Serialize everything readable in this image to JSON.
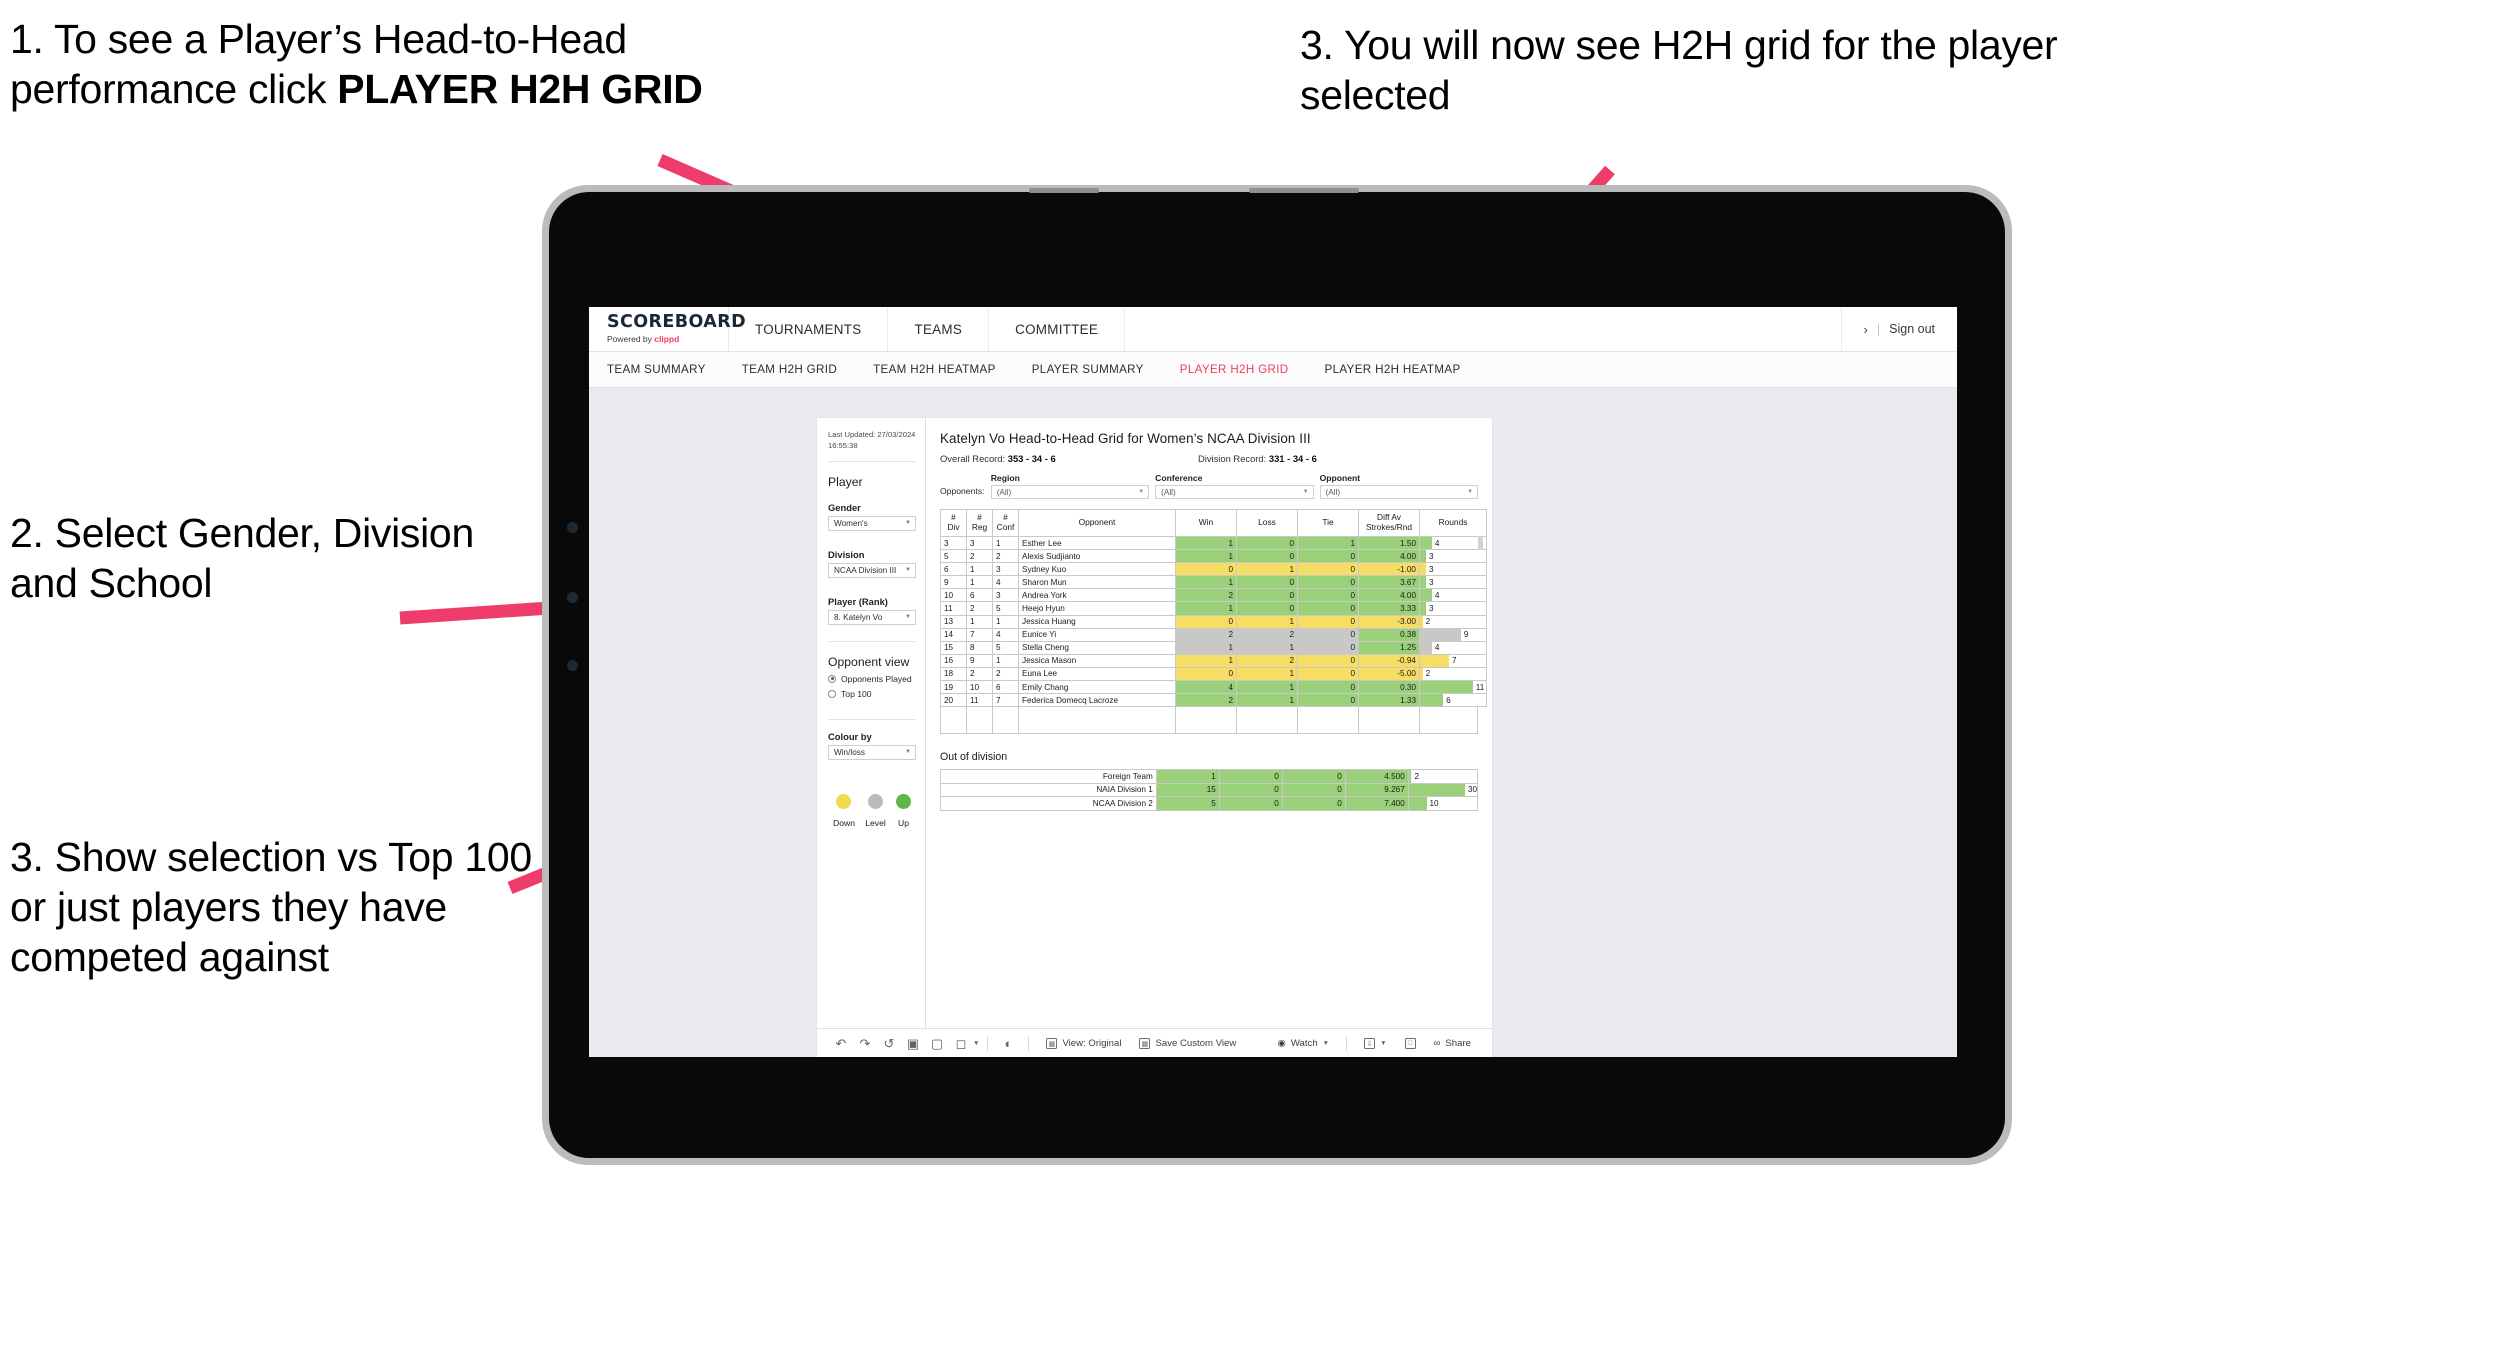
{
  "annotations": {
    "step1_a": "1. To see a Player’s Head-to-Head performance click ",
    "step1_bold": "PLAYER H2H GRID",
    "step2": "2. Select Gender, Division and School",
    "step3_left": "3. Show selection vs Top 100 or just players they have competed against",
    "step3_right": "3. You will now see H2H grid for the player selected"
  },
  "colors": {
    "accent_pink": "#ee3d6b",
    "brand_red": "#ef3e5c",
    "up_green": "#9bd07a",
    "down_yellow": "#f5de63",
    "level_grey": "#c8c8c8",
    "canvas_grey": "#e9ebee"
  },
  "brand": {
    "logo_word": "SCOREBOARD",
    "logo_powered": "Powered by ",
    "logo_partner": "clippd"
  },
  "topnav": {
    "items": [
      {
        "label": "TOURNAMENTS"
      },
      {
        "label": "TEAMS"
      },
      {
        "label": "COMMITTEE"
      }
    ],
    "chevron": "›",
    "separator": "|",
    "signout": "Sign out"
  },
  "subnav": {
    "items": [
      {
        "label": "TEAM SUMMARY",
        "active": false
      },
      {
        "label": "TEAM H2H GRID",
        "active": false
      },
      {
        "label": "TEAM H2H HEATMAP",
        "active": false
      },
      {
        "label": "PLAYER SUMMARY",
        "active": false
      },
      {
        "label": "PLAYER H2H GRID",
        "active": true
      },
      {
        "label": "PLAYER H2H HEATMAP",
        "active": false
      }
    ]
  },
  "controls": {
    "last_updated": "Last Updated: 27/03/2024 16:55:38",
    "player_heading": "Player",
    "gender_label": "Gender",
    "gender_value": "Women's",
    "division_label": "Division",
    "division_value": "NCAA Division III",
    "player_rank_label": "Player (Rank)",
    "player_rank_value": "8. Katelyn Vo",
    "opponent_view_heading": "Opponent view",
    "opponent_view_options": [
      {
        "label": "Opponents Played",
        "selected": true
      },
      {
        "label": "Top 100",
        "selected": false
      }
    ],
    "colour_by_label": "Colour by",
    "colour_by_value": "Win/loss",
    "legend": [
      {
        "name": "Down",
        "color": "#f5de63"
      },
      {
        "name": "Level",
        "color": "#c8c8c8"
      },
      {
        "name": "Up",
        "color": "#7ec45a"
      }
    ]
  },
  "main": {
    "title": "Katelyn Vo Head-to-Head Grid for Women’s NCAA Division III",
    "overall_record_label": "Overall Record: ",
    "overall_record_value": "353 -  34 - 6",
    "division_record_label": "Division Record: ",
    "division_record_value": "331 -  34 - 6",
    "opponents_label": "Opponents:",
    "filters": [
      {
        "label": "Region",
        "value": "(All)"
      },
      {
        "label": "Conference",
        "value": "(All)"
      },
      {
        "label": "Opponent",
        "value": "(All)"
      }
    ]
  },
  "chart_data": {
    "type": "table",
    "title": "Katelyn Vo Head-to-Head Grid for Women’s NCAA Division III",
    "columns": [
      "# Div",
      "# Reg",
      "# Conf",
      "Opponent",
      "Win",
      "Loss",
      "Tie",
      "Diff Av Strokes/Rnd",
      "Rounds"
    ],
    "column_headers_multiline": [
      [
        "#",
        "Div"
      ],
      [
        "#",
        "Reg"
      ],
      [
        "#",
        "Conf"
      ],
      [
        "Opponent"
      ],
      [
        "Win"
      ],
      [
        "Loss"
      ],
      [
        "Tie"
      ],
      [
        "Diff Av",
        "Strokes/Rnd"
      ],
      [
        "Rounds"
      ]
    ],
    "rows": [
      {
        "div": "3",
        "reg": "3",
        "conf": "1",
        "opponent": "Esther Lee",
        "win": "1",
        "loss": "0",
        "tie": "1",
        "diff": "1.50",
        "rounds": "4",
        "bar_pct": 18,
        "state": "up"
      },
      {
        "div": "5",
        "reg": "2",
        "conf": "2",
        "opponent": "Alexis Sudjianto",
        "win": "1",
        "loss": "0",
        "tie": "0",
        "diff": "4.00",
        "rounds": "3",
        "bar_pct": 9,
        "state": "up"
      },
      {
        "div": "6",
        "reg": "1",
        "conf": "3",
        "opponent": "Sydney Kuo",
        "win": "0",
        "loss": "1",
        "tie": "0",
        "diff": "-1.00",
        "rounds": "3",
        "bar_pct": 9,
        "state": "down"
      },
      {
        "div": "9",
        "reg": "1",
        "conf": "4",
        "opponent": "Sharon Mun",
        "win": "1",
        "loss": "0",
        "tie": "0",
        "diff": "3.67",
        "rounds": "3",
        "bar_pct": 9,
        "state": "up"
      },
      {
        "div": "10",
        "reg": "6",
        "conf": "3",
        "opponent": "Andrea York",
        "win": "2",
        "loss": "0",
        "tie": "0",
        "diff": "4.00",
        "rounds": "4",
        "bar_pct": 18,
        "state": "up"
      },
      {
        "div": "11",
        "reg": "2",
        "conf": "5",
        "opponent": "Heejo Hyun",
        "win": "1",
        "loss": "0",
        "tie": "0",
        "diff": "3.33",
        "rounds": "3",
        "bar_pct": 9,
        "state": "up"
      },
      {
        "div": "13",
        "reg": "1",
        "conf": "1",
        "opponent": "Jessica Huang",
        "win": "0",
        "loss": "1",
        "tie": "0",
        "diff": "-3.00",
        "rounds": "2",
        "bar_pct": 4,
        "state": "down"
      },
      {
        "div": "14",
        "reg": "7",
        "conf": "4",
        "opponent": "Eunice Yi",
        "win": "2",
        "loss": "2",
        "tie": "0",
        "diff": "0.38",
        "rounds": "9",
        "bar_pct": 62,
        "state": "level",
        "diff_state": "up"
      },
      {
        "div": "15",
        "reg": "8",
        "conf": "5",
        "opponent": "Stella Cheng",
        "win": "1",
        "loss": "1",
        "tie": "0",
        "diff": "1.25",
        "rounds": "4",
        "bar_pct": 18,
        "state": "level",
        "diff_state": "up"
      },
      {
        "div": "16",
        "reg": "9",
        "conf": "1",
        "opponent": "Jessica Mason",
        "win": "1",
        "loss": "2",
        "tie": "0",
        "diff": "-0.94",
        "rounds": "7",
        "bar_pct": 44,
        "state": "down"
      },
      {
        "div": "18",
        "reg": "2",
        "conf": "2",
        "opponent": "Euna Lee",
        "win": "0",
        "loss": "1",
        "tie": "0",
        "diff": "-5.00",
        "rounds": "2",
        "bar_pct": 4,
        "state": "down"
      },
      {
        "div": "19",
        "reg": "10",
        "conf": "6",
        "opponent": "Emily Chang",
        "win": "4",
        "loss": "1",
        "tie": "0",
        "diff": "0.30",
        "rounds": "11",
        "bar_pct": 80,
        "state": "up"
      },
      {
        "div": "20",
        "reg": "11",
        "conf": "7",
        "opponent": "Federica Domecq Lacroze",
        "win": "2",
        "loss": "1",
        "tie": "0",
        "diff": "1.33",
        "rounds": "6",
        "bar_pct": 35,
        "state": "up"
      }
    ],
    "out_of_division_heading": "Out of division",
    "out_of_division": [
      {
        "name": "Foreign Team",
        "win": "1",
        "loss": "0",
        "tie": "0",
        "diff": "4.500",
        "rounds": "2",
        "bar_pct": 4,
        "state": "up"
      },
      {
        "name": "NAIA Division 1",
        "win": "15",
        "loss": "0",
        "tie": "0",
        "diff": "9.267",
        "rounds": "30",
        "bar_pct": 91,
        "state": "up"
      },
      {
        "name": "NCAA Division 2",
        "win": "5",
        "loss": "0",
        "tie": "0",
        "diff": "7.400",
        "rounds": "10",
        "bar_pct": 26,
        "state": "up"
      }
    ]
  },
  "toolbar": {
    "view_label": "View: Original",
    "save_label": "Save Custom View",
    "watch_label": "Watch",
    "share_label": "Share"
  }
}
